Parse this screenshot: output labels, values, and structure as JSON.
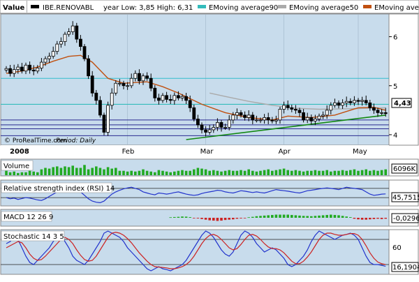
{
  "header": {
    "value_label": "Value",
    "symbol": "IBE.RENOVABL",
    "year_range": "year Low: 3,85 High: 6,31",
    "legend": [
      {
        "label": "EMoving average90",
        "color": "#33bbbb"
      },
      {
        "label": "EMoving average50",
        "color": "#aaaaaa"
      },
      {
        "label": "EMoving aver",
        "color": "#c05010"
      }
    ]
  },
  "colors": {
    "panel_bg": "#c8dcec",
    "ema90": "#33bbbb",
    "ema50": "#aaaaaa",
    "ema20": "#c05010",
    "trendline": "#118811",
    "hline": "#2a2a90",
    "volume_bar": "#22aa22",
    "rsi_line": "#2233cc",
    "macd_pos": "#22aa22",
    "macd_neg": "#cc2222",
    "stoch_k": "#2233cc",
    "stoch_d": "#cc2222",
    "candle_up": "#ffffff",
    "candle_down": "#000000"
  },
  "chart_data": [
    {
      "type": "candlestick",
      "title": "IBE.RENOVABL",
      "period": "Daily",
      "source": "© ProRealTime.com",
      "ylim": [
        3.8,
        6.45
      ],
      "y_ticks": [
        "6",
        "5",
        "4"
      ],
      "x_labels": [
        "2008",
        "Feb",
        "Mar",
        "Apr",
        "May"
      ],
      "last_value": "4,43",
      "closes": [
        5.35,
        5.25,
        5.33,
        5.38,
        5.3,
        5.42,
        5.32,
        5.3,
        5.36,
        5.48,
        5.55,
        5.6,
        5.7,
        5.85,
        5.9,
        6.05,
        6.1,
        6.22,
        5.95,
        5.8,
        5.55,
        5.2,
        4.85,
        4.7,
        4.4,
        4.05,
        4.6,
        4.85,
        5.05,
        5.05,
        5.0,
        5.0,
        5.15,
        5.25,
        5.1,
        5.2,
        5.15,
        4.95,
        4.75,
        4.7,
        4.8,
        4.72,
        4.7,
        4.8,
        4.75,
        4.78,
        4.7,
        4.55,
        4.32,
        4.2,
        4.1,
        4.05,
        4.1,
        4.15,
        4.25,
        4.15,
        4.15,
        4.3,
        4.4,
        4.45,
        4.4,
        4.35,
        4.4,
        4.3,
        4.3,
        4.3,
        4.35,
        4.3,
        4.28,
        4.3,
        4.52,
        4.6,
        4.55,
        4.52,
        4.5,
        4.45,
        4.3,
        4.35,
        4.28,
        4.32,
        4.38,
        4.4,
        4.5,
        4.6,
        4.65,
        4.6,
        4.65,
        4.68,
        4.65,
        4.7,
        4.68,
        4.7,
        4.65,
        4.55,
        4.5,
        4.45,
        4.45,
        4.43
      ],
      "series": [
        {
          "name": "EMoving average90",
          "color": "#33bbbb",
          "ref": "ema90"
        },
        {
          "name": "EMoving average50",
          "color": "#aaaaaa",
          "ref": "ema50"
        },
        {
          "name": "EMoving aver",
          "color": "#c05010",
          "ref": "ema20"
        }
      ],
      "ema90": [
        4.62,
        4.62
      ],
      "ema50": [
        [
          52,
          4.85
        ],
        [
          56,
          4.78
        ],
        [
          62,
          4.68
        ],
        [
          68,
          4.6
        ],
        [
          74,
          4.54
        ],
        [
          80,
          4.52
        ],
        [
          88,
          4.53
        ],
        [
          97,
          4.55
        ]
      ],
      "ema20": [
        [
          0,
          5.25
        ],
        [
          4,
          5.3
        ],
        [
          8,
          5.38
        ],
        [
          12,
          5.5
        ],
        [
          16,
          5.6
        ],
        [
          19,
          5.62
        ],
        [
          22,
          5.48
        ],
        [
          26,
          5.15
        ],
        [
          30,
          5.05
        ],
        [
          36,
          5.08
        ],
        [
          40,
          4.98
        ],
        [
          44,
          4.85
        ],
        [
          50,
          4.62
        ],
        [
          56,
          4.45
        ],
        [
          62,
          4.35
        ],
        [
          68,
          4.3
        ],
        [
          72,
          4.38
        ],
        [
          78,
          4.35
        ],
        [
          84,
          4.4
        ],
        [
          90,
          4.55
        ],
        [
          94,
          4.56
        ],
        [
          97,
          4.5
        ]
      ],
      "trendline": [
        [
          46,
          3.9
        ],
        [
          97,
          4.4
        ]
      ],
      "hlines": [
        5.15,
        4.62,
        4.3,
        4.2,
        4.12,
        3.98
      ]
    },
    {
      "type": "bar",
      "title": "Volume",
      "last_value": "6096K",
      "ylim": [
        0,
        1
      ],
      "values": [
        0.3,
        0.2,
        0.25,
        0.15,
        0.2,
        0.2,
        0.3,
        0.25,
        0.2,
        0.4,
        0.5,
        0.45,
        0.55,
        0.6,
        0.5,
        0.6,
        0.55,
        0.65,
        0.5,
        0.5,
        0.7,
        0.4,
        0.5,
        0.6,
        0.5,
        0.4,
        0.55,
        0.45,
        0.5,
        0.3,
        0.3,
        0.25,
        0.3,
        0.25,
        0.3,
        0.4,
        0.3,
        0.25,
        0.2,
        0.35,
        0.3,
        0.25,
        0.2,
        0.25,
        0.3,
        0.35,
        0.3,
        0.3,
        0.4,
        0.5,
        0.45,
        0.4,
        0.3,
        0.35,
        0.3,
        0.25,
        0.3,
        0.35,
        0.3,
        0.3,
        0.35,
        0.3,
        0.4,
        0.3,
        0.25,
        0.3,
        0.35,
        0.4,
        0.3,
        0.35,
        0.4,
        0.45,
        0.35,
        0.3,
        0.35,
        0.3,
        0.25,
        0.3,
        0.3,
        0.35,
        0.3,
        0.3,
        0.35,
        0.25,
        0.3,
        0.3,
        0.35,
        0.3,
        0.35,
        0.4,
        0.3,
        0.35,
        0.4,
        0.3,
        0.35,
        0.3,
        0.35,
        0.4
      ]
    },
    {
      "type": "line",
      "title": "Relative strength index (RSI) 14",
      "last_value": "45,7515",
      "ylim": [
        0,
        100
      ],
      "y_ref_lines": [
        70,
        30
      ],
      "values": [
        30,
        25,
        28,
        22,
        26,
        30,
        28,
        24,
        20,
        18,
        25,
        35,
        45,
        55,
        60,
        65,
        70,
        72,
        65,
        55,
        40,
        25,
        15,
        10,
        8,
        15,
        30,
        45,
        55,
        62,
        68,
        72,
        75,
        70,
        65,
        55,
        50,
        45,
        42,
        50,
        48,
        45,
        48,
        52,
        55,
        50,
        45,
        42,
        40,
        42,
        48,
        52,
        55,
        58,
        62,
        60,
        55,
        52,
        50,
        55,
        60,
        58,
        55,
        52,
        55,
        52,
        50,
        55,
        60,
        65,
        62,
        60,
        58,
        55,
        52,
        50,
        55,
        60,
        62,
        65,
        68,
        70,
        72,
        70,
        68,
        65,
        70,
        75,
        72,
        70,
        68,
        65,
        55,
        45,
        40,
        42,
        45,
        46
      ]
    },
    {
      "type": "bar",
      "title": "MACD 12 26 9",
      "last_value": "-0,0296",
      "ylim": [
        -1,
        1
      ],
      "start_index": 42,
      "values": [
        0.08,
        0.12,
        0.15,
        0.2,
        0.18,
        0.1,
        -0.05,
        -0.1,
        -0.2,
        -0.3,
        -0.4,
        -0.45,
        -0.5,
        -0.45,
        -0.35,
        -0.3,
        -0.25,
        -0.15,
        -0.1,
        -0.05,
        0.08,
        0.15,
        0.25,
        0.3,
        0.35,
        0.4,
        0.45,
        0.5,
        0.5,
        0.5,
        0.5,
        0.45,
        0.4,
        0.35,
        0.3,
        0.28,
        0.25,
        0.3,
        0.35,
        0.4,
        0.45,
        0.5,
        0.45,
        0.4,
        0.3,
        0.2,
        0.1,
        -0.15,
        -0.25,
        -0.3,
        -0.3,
        -0.25,
        -0.2,
        -0.15,
        -0.2,
        -0.15
      ]
    },
    {
      "type": "line",
      "title": "Stochastic 14 3 5",
      "last_value": "16,1904",
      "ylim": [
        0,
        100
      ],
      "y_ticks": [
        "60"
      ],
      "y_ref_lines": [
        80,
        20
      ],
      "series": [
        {
          "name": "",
          "color": "#2233cc",
          "values": [
            70,
            75,
            85,
            80,
            60,
            40,
            25,
            20,
            30,
            40,
            50,
            60,
            75,
            85,
            90,
            75,
            60,
            40,
            30,
            25,
            20,
            30,
            45,
            60,
            75,
            95,
            100,
            95,
            90,
            85,
            75,
            60,
            50,
            40,
            30,
            20,
            10,
            5,
            10,
            15,
            10,
            8,
            5,
            10,
            15,
            20,
            30,
            45,
            60,
            75,
            90,
            100,
            95,
            85,
            70,
            55,
            45,
            40,
            50,
            70,
            90,
            100,
            95,
            85,
            70,
            60,
            50,
            55,
            60,
            55,
            45,
            35,
            20,
            15,
            20,
            30,
            40,
            55,
            75,
            90,
            100,
            95,
            90,
            85,
            80,
            85,
            90,
            92,
            95,
            90,
            80,
            60,
            40,
            25,
            20,
            20,
            18,
            16
          ]
        },
        {
          "name": "",
          "color": "#cc2222",
          "values": [
            60,
            65,
            70,
            75,
            72,
            60,
            45,
            35,
            30,
            32,
            40,
            50,
            60,
            70,
            80,
            85,
            80,
            70,
            55,
            42,
            32,
            28,
            30,
            40,
            55,
            70,
            85,
            95,
            97,
            95,
            90,
            82,
            72,
            60,
            48,
            38,
            28,
            20,
            15,
            14,
            13,
            12,
            10,
            10,
            12,
            15,
            20,
            28,
            40,
            55,
            70,
            82,
            90,
            92,
            88,
            80,
            70,
            60,
            55,
            58,
            68,
            80,
            90,
            92,
            88,
            80,
            70,
            62,
            58,
            58,
            55,
            48,
            38,
            28,
            22,
            22,
            28,
            38,
            50,
            65,
            80,
            90,
            95,
            95,
            92,
            90,
            90,
            92,
            94,
            94,
            90,
            80,
            65,
            48,
            35,
            26,
            22,
            20
          ]
        }
      ]
    }
  ]
}
